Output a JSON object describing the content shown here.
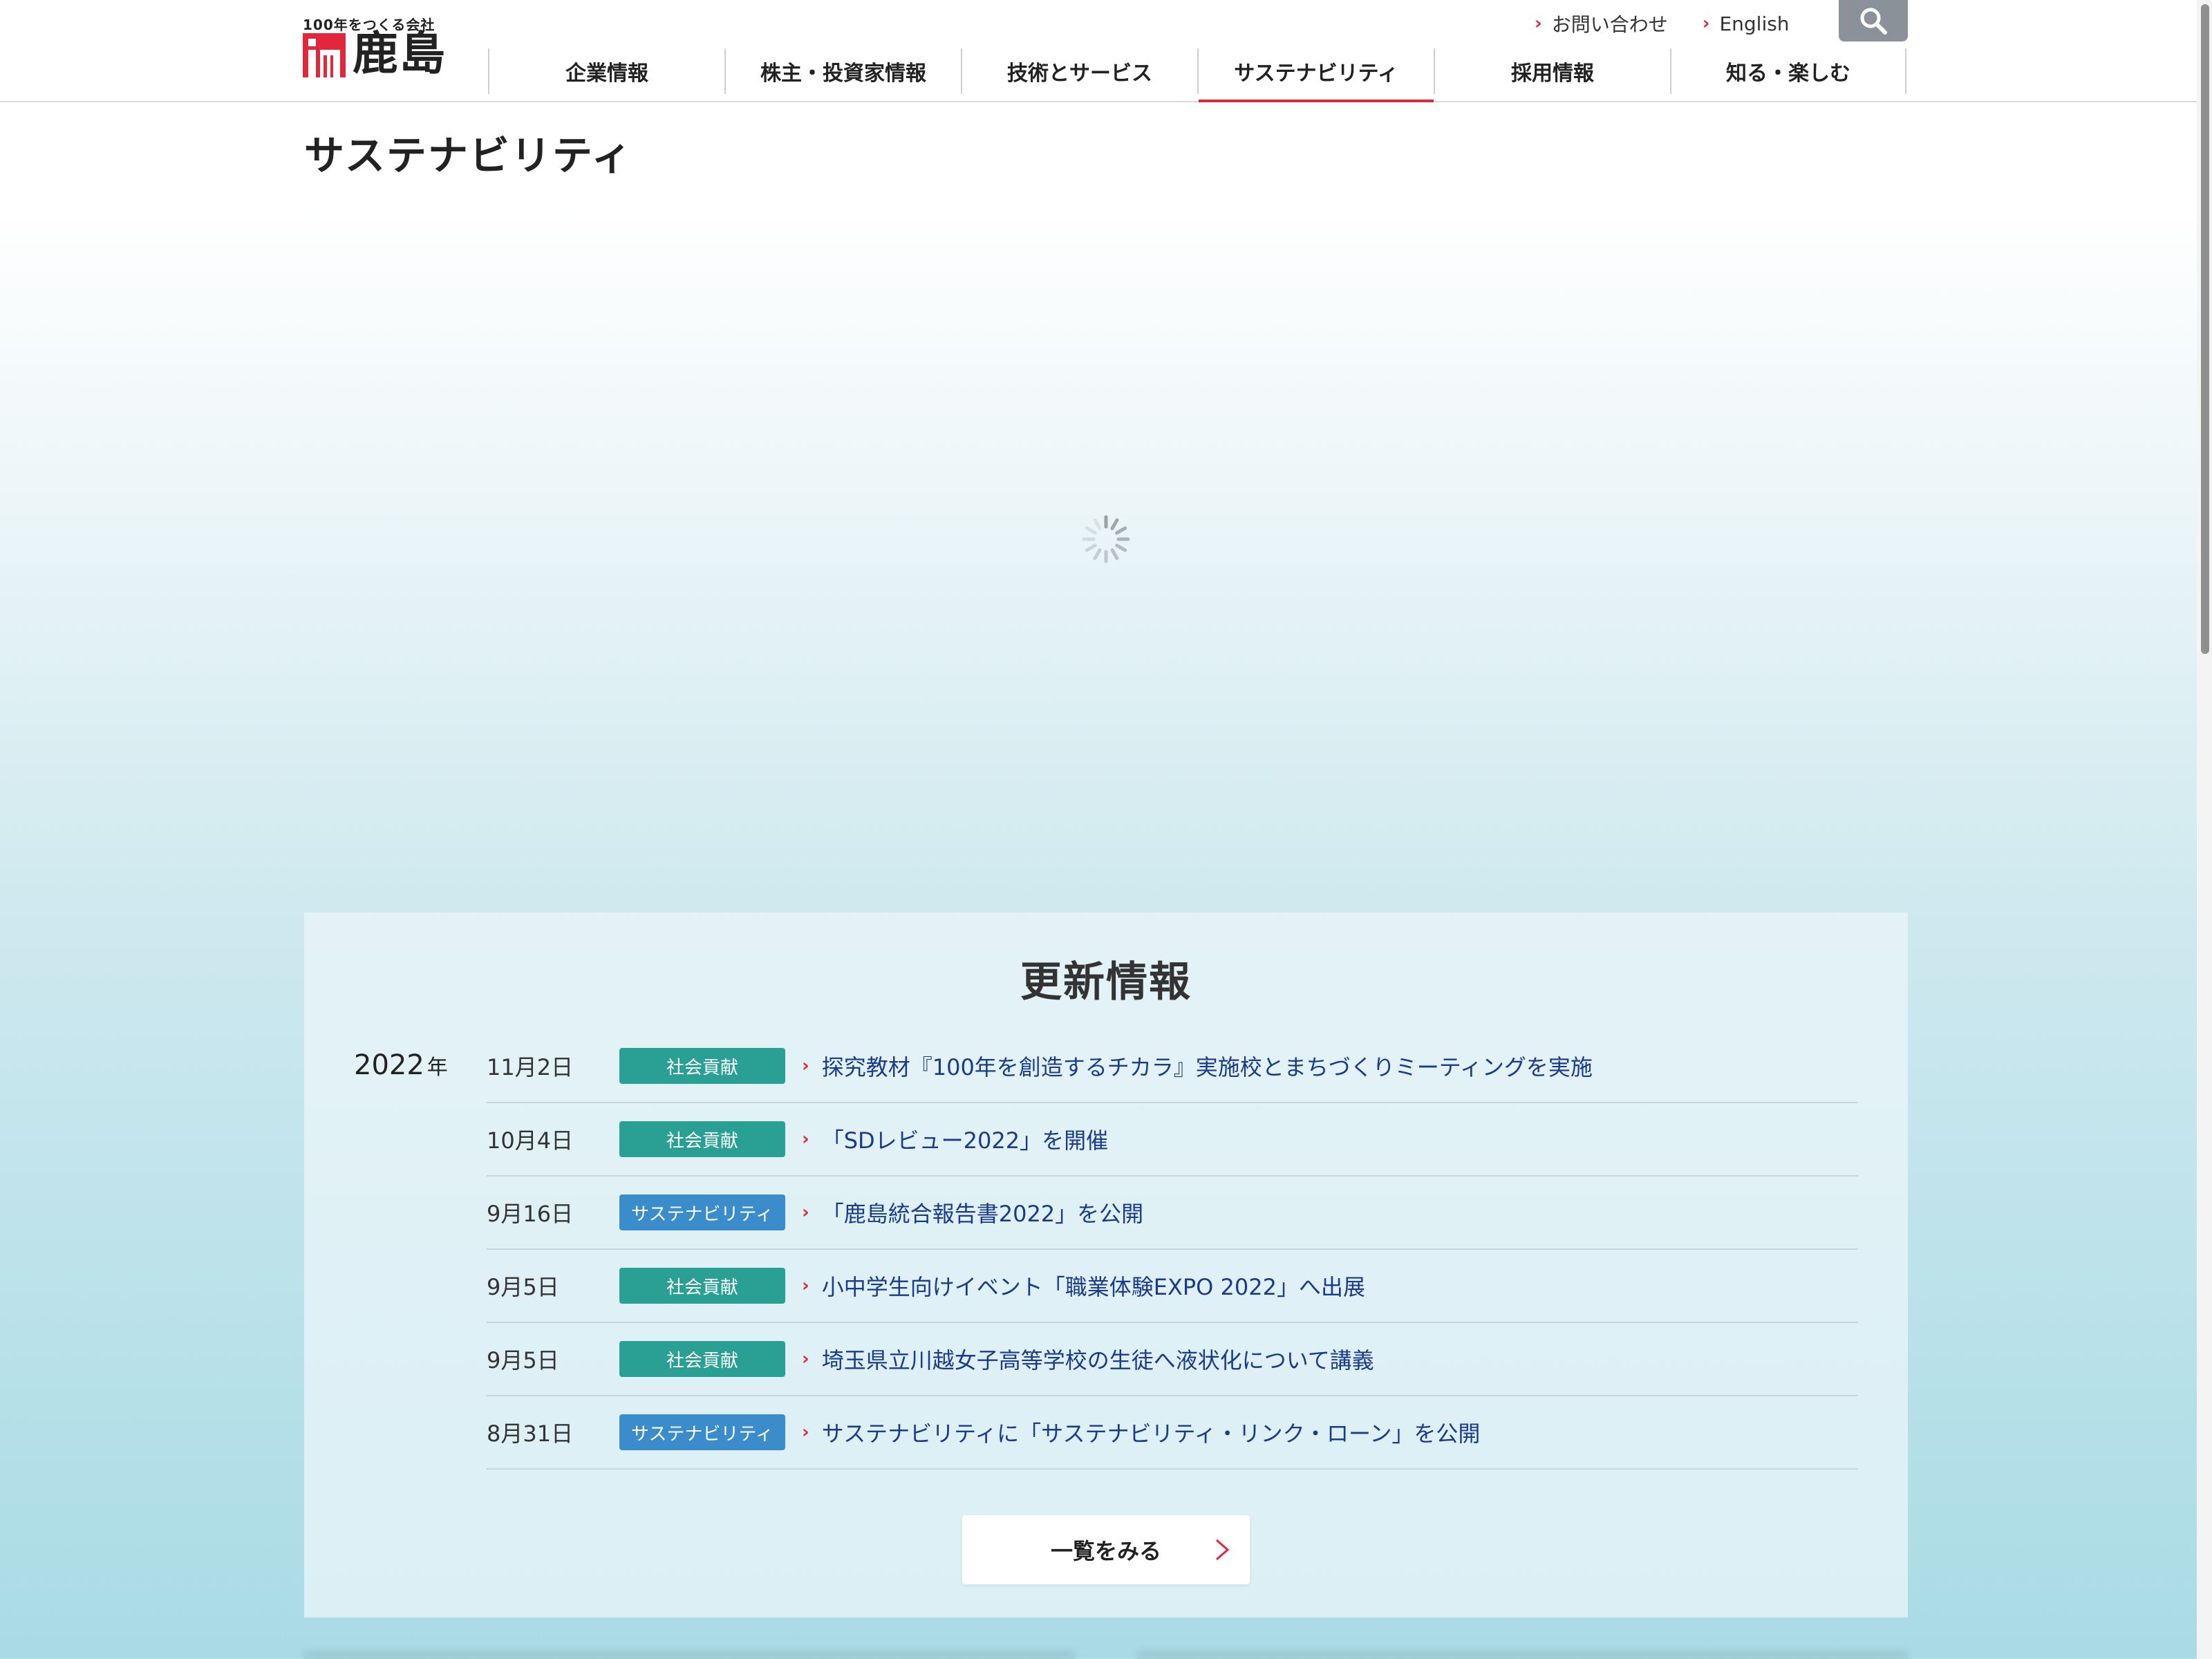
{
  "header": {
    "logo_tagline": "100年をつくる会社",
    "logo_name": "鹿島",
    "util_links": [
      {
        "label": "お問い合わせ"
      },
      {
        "label": "English"
      }
    ],
    "search_icon": "search-icon",
    "nav": [
      {
        "label": "企業情報"
      },
      {
        "label": "株主・投資家情報"
      },
      {
        "label": "技術とサービス"
      },
      {
        "label": "サステナビリティ",
        "active": true
      },
      {
        "label": "採用情報"
      },
      {
        "label": "知る・楽しむ"
      }
    ]
  },
  "page": {
    "title": "サステナビリティ",
    "loading_icon": "spinner-icon"
  },
  "updates": {
    "title": "更新情報",
    "year": "2022",
    "year_unit": "年",
    "items": [
      {
        "date": "11月2日",
        "category": "社会貢献",
        "text": "探究教材『100年を創造するチカラ』実施校とまちづくりミーティングを実施"
      },
      {
        "date": "10月4日",
        "category": "社会貢献",
        "text": "「SDレビュー2022」を開催"
      },
      {
        "date": "9月16日",
        "category": "サステナビリティ",
        "text": "「鹿島統合報告書2022」を公開"
      },
      {
        "date": "9月5日",
        "category": "社会貢献",
        "text": "小中学生向けイベント「職業体験EXPO 2022」へ出展"
      },
      {
        "date": "9月5日",
        "category": "社会貢献",
        "text": "埼玉県立川越女子高等学校の生徒へ液状化について講義"
      },
      {
        "date": "8月31日",
        "category": "サステナビリティ",
        "text": "サステナビリティに「サステナビリティ・リンク・ローン」を公開"
      }
    ],
    "more_label": "一覧をみる"
  },
  "colors": {
    "accent_red": "#e2263b",
    "badge_social": "#2aa095",
    "badge_sustainability": "#3b8ccb",
    "link_blue": "#1a3a8c"
  }
}
